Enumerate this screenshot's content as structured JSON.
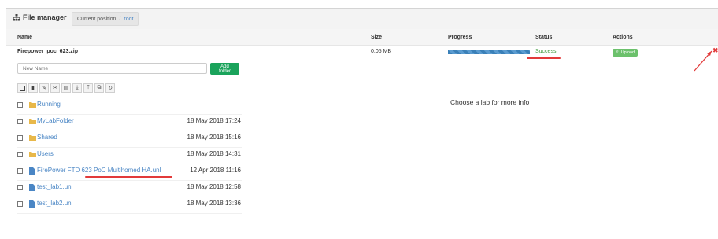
{
  "header": {
    "title": "File manager",
    "current_position_label": "Current position",
    "current_position_value": "root"
  },
  "upload_table": {
    "columns": [
      "Name",
      "Size",
      "Progress",
      "Status",
      "Actions"
    ],
    "row": {
      "name": "Firepower_poc_623.zip",
      "size": "0.05 MB",
      "progress": 1.0,
      "status": "Success",
      "action_label": "Upload"
    }
  },
  "new_name": {
    "placeholder": "New Name",
    "add_folder_label": "Add folder"
  },
  "toolbar": {
    "buttons": [
      "select-all",
      "new-file",
      "edit",
      "cut",
      "delete",
      "import",
      "export",
      "clone",
      "refresh"
    ]
  },
  "files": [
    {
      "name": "Running",
      "date": "",
      "type": "folder"
    },
    {
      "name": "MyLabFolder",
      "date": "18 May 2018 17:24",
      "type": "folder"
    },
    {
      "name": "Shared",
      "date": "18 May 2018 15:16",
      "type": "folder"
    },
    {
      "name": "Users",
      "date": "18 May 2018 14:31",
      "type": "folder"
    },
    {
      "name": "FirePower FTD 623 PoC Multihomed HA.unl",
      "date": "12 Apr 2018 11:16",
      "type": "file"
    },
    {
      "name": "test_lab1.unl",
      "date": "18 May 2018 12:58",
      "type": "file"
    },
    {
      "name": "test_lab2.unl",
      "date": "18 May 2018 13:36",
      "type": "file"
    }
  ],
  "info_panel": {
    "message": "Choose a lab for more info"
  },
  "colors": {
    "accent": "#4a86c5",
    "success": "#3c9a3c",
    "add_folder": "#1aa35b",
    "annotation": "#e23a3a"
  }
}
